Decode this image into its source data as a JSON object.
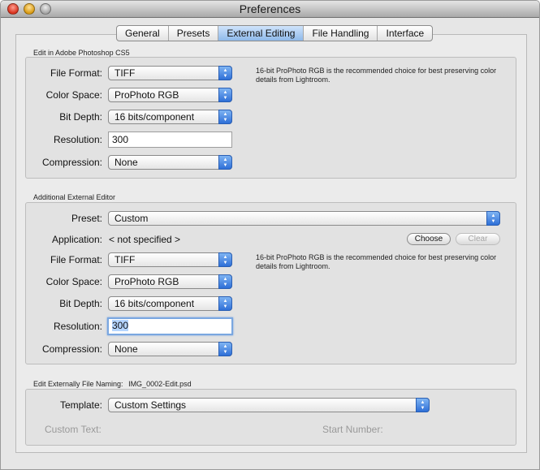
{
  "window": {
    "title": "Preferences"
  },
  "tabs": [
    "General",
    "Presets",
    "External Editing",
    "File Handling",
    "Interface"
  ],
  "active_tab": "External Editing",
  "photoshop": {
    "heading": "Edit in Adobe Photoshop CS5",
    "file_format_label": "File Format:",
    "file_format": "TIFF",
    "color_space_label": "Color Space:",
    "color_space": "ProPhoto RGB",
    "bit_depth_label": "Bit Depth:",
    "bit_depth": "16 bits/component",
    "resolution_label": "Resolution:",
    "resolution": "300",
    "compression_label": "Compression:",
    "compression": "None",
    "note": "16-bit ProPhoto RGB is the recommended choice for best preserving color details from Lightroom."
  },
  "additional": {
    "heading": "Additional External Editor",
    "preset_label": "Preset:",
    "preset": "Custom",
    "application_label": "Application:",
    "application": "< not specified >",
    "choose_label": "Choose",
    "clear_label": "Clear",
    "file_format_label": "File Format:",
    "file_format": "TIFF",
    "color_space_label": "Color Space:",
    "color_space": "ProPhoto RGB",
    "bit_depth_label": "Bit Depth:",
    "bit_depth": "16 bits/component",
    "resolution_label": "Resolution:",
    "resolution": "300",
    "compression_label": "Compression:",
    "compression": "None",
    "note": "16-bit ProPhoto RGB is the recommended choice for best preserving color details from Lightroom."
  },
  "naming": {
    "heading": "Edit Externally File Naming:",
    "example": "IMG_0002-Edit.psd",
    "template_label": "Template:",
    "template": "Custom Settings",
    "custom_text_label": "Custom Text:",
    "start_number_label": "Start Number:"
  }
}
